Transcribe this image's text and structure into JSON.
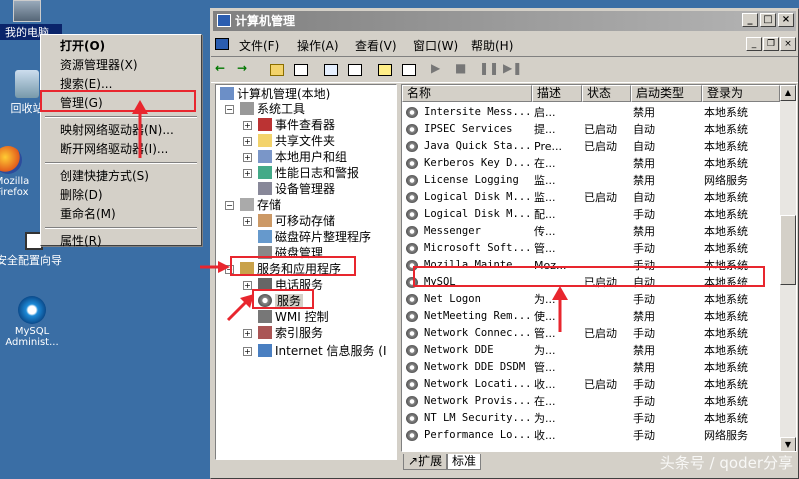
{
  "desktop": {
    "icons": [
      {
        "label": "我的电脑"
      },
      {
        "label": "回收站"
      },
      {
        "label": "Mozilla Firefox"
      },
      {
        "label": "安全配置向导"
      },
      {
        "label": "MySQL Administ..."
      }
    ]
  },
  "context_menu": {
    "items": [
      "打开(O)",
      "资源管理器(X)",
      "搜索(E)...",
      "管理(G)",
      "映射网络驱动器(N)...",
      "断开网络驱动器(I)...",
      "创建快捷方式(S)",
      "删除(D)",
      "重命名(M)",
      "属性(R)"
    ]
  },
  "window": {
    "title": "计算机管理",
    "menu": [
      "文件(F)",
      "操作(A)",
      "查看(V)",
      "窗口(W)",
      "帮助(H)"
    ],
    "tree": {
      "root": "计算机管理(本地)",
      "system_tools": "系统工具",
      "event_viewer": "事件查看器",
      "shared_folders": "共享文件夹",
      "local_users": "本地用户和组",
      "perf_logs": "性能日志和警报",
      "device_manager": "设备管理器",
      "storage": "存储",
      "removable_storage": "可移动存储",
      "defrag": "磁盘碎片整理程序",
      "disk_mgmt": "磁盘管理",
      "services_apps": "服务和应用程序",
      "telephony": "电话服务",
      "services": "服务",
      "wmi": "WMI 控制",
      "indexing": "索引服务",
      "iis": "Internet 信息服务 (I"
    },
    "columns": [
      "名称",
      "描述",
      "状态",
      "启动类型",
      "登录为"
    ],
    "services": [
      [
        "Intersite Mess...",
        "启...",
        "",
        "禁用",
        "本地系统"
      ],
      [
        "IPSEC Services",
        "提...",
        "已启动",
        "自动",
        "本地系统"
      ],
      [
        "Java Quick Sta...",
        "Pre...",
        "已启动",
        "自动",
        "本地系统"
      ],
      [
        "Kerberos Key D...",
        "在...",
        "",
        "禁用",
        "本地系统"
      ],
      [
        "License Logging",
        "监...",
        "",
        "禁用",
        "网络服务"
      ],
      [
        "Logical Disk M...",
        "监...",
        "已启动",
        "自动",
        "本地系统"
      ],
      [
        "Logical Disk M...",
        "配...",
        "",
        "手动",
        "本地系统"
      ],
      [
        "Messenger",
        "传...",
        "",
        "禁用",
        "本地系统"
      ],
      [
        "Microsoft Soft...",
        "管...",
        "",
        "手动",
        "本地系统"
      ],
      [
        "Mozilla Mainte...",
        "Moz...",
        "",
        "手动",
        "本地系统"
      ],
      [
        "MySQL",
        "",
        "已启动",
        "自动",
        "本地系统"
      ],
      [
        "Net Logon",
        "为...",
        "",
        "手动",
        "本地系统"
      ],
      [
        "NetMeeting Rem...",
        "使...",
        "",
        "禁用",
        "本地系统"
      ],
      [
        "Network Connec...",
        "管...",
        "已启动",
        "手动",
        "本地系统"
      ],
      [
        "Network DDE",
        "为...",
        "",
        "禁用",
        "本地系统"
      ],
      [
        "Network DDE DSDM",
        "管...",
        "",
        "禁用",
        "本地系统"
      ],
      [
        "Network Locati...",
        "收...",
        "已启动",
        "手动",
        "本地系统"
      ],
      [
        "Network Provis...",
        "在...",
        "",
        "手动",
        "本地系统"
      ],
      [
        "NT LM Security...",
        "为...",
        "",
        "手动",
        "本地系统"
      ],
      [
        "Performance Lo...",
        "收...",
        "",
        "手动",
        "网络服务"
      ]
    ],
    "tabs": [
      "扩展",
      "标准"
    ]
  },
  "watermark": "头条号 / qoder分享"
}
